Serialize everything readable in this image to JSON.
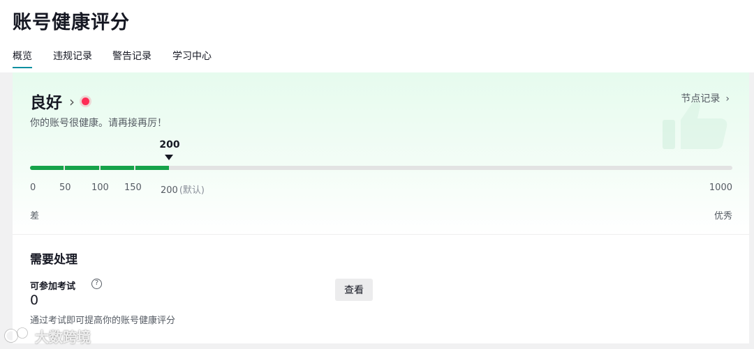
{
  "page": {
    "title": "账号健康评分"
  },
  "tabs": [
    {
      "label": "概览",
      "active": true
    },
    {
      "label": "违规记录",
      "active": false
    },
    {
      "label": "警告记录",
      "active": false
    },
    {
      "label": "学习中心",
      "active": false
    }
  ],
  "status": {
    "title": "良好",
    "description": "你的账号很健康。请再接再厉！",
    "record_link": "节点记录"
  },
  "score": {
    "current_label": "200",
    "current": 200,
    "max": 1000,
    "ticks": [
      "0",
      "50",
      "100",
      "150",
      "200"
    ],
    "default_note": "(默认)",
    "max_label": "1000",
    "low_label": "差",
    "high_label": "优秀"
  },
  "todo": {
    "section_title": "需要处理",
    "item_label": "可参加考试",
    "item_value": "0",
    "item_hint": "通过考试即可提高你的账号健康评分",
    "button_label": "查看"
  },
  "colors": {
    "bar_fill": "#16a34a",
    "accent_tab": "#0a8fa0",
    "status_dot": "#fe2c55"
  },
  "watermark": {
    "text": "大数跨境"
  }
}
